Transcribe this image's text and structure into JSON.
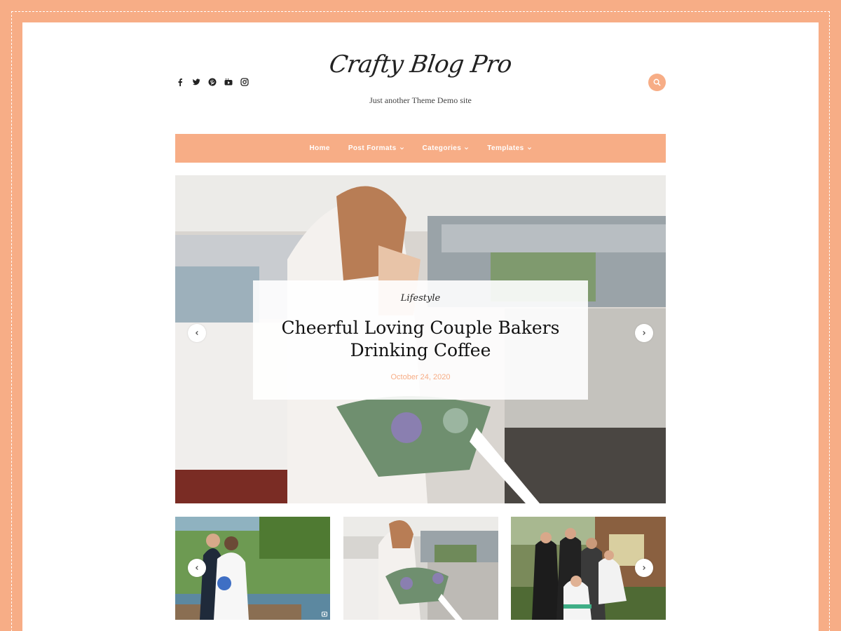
{
  "site": {
    "title": "Crafty Blog Pro",
    "tagline": "Just another Theme Demo site",
    "accent_color": "#f7ad86"
  },
  "social_icons": [
    "facebook-icon",
    "twitter-icon",
    "pinterest-icon",
    "youtube-icon",
    "instagram-icon"
  ],
  "search": {
    "icon": "search-icon"
  },
  "nav": {
    "items": [
      {
        "label": "Home",
        "has_submenu": false
      },
      {
        "label": "Post Formats",
        "has_submenu": true
      },
      {
        "label": "Categories",
        "has_submenu": true
      },
      {
        "label": "Templates",
        "has_submenu": true
      }
    ]
  },
  "featured": {
    "category": "Lifestyle",
    "title": "Cheerful Loving Couple Bakers Drinking Coffee",
    "date": "October 24, 2020"
  },
  "carousel": {
    "prev_icon": "chevron-left-icon",
    "next_icon": "chevron-right-icon"
  }
}
